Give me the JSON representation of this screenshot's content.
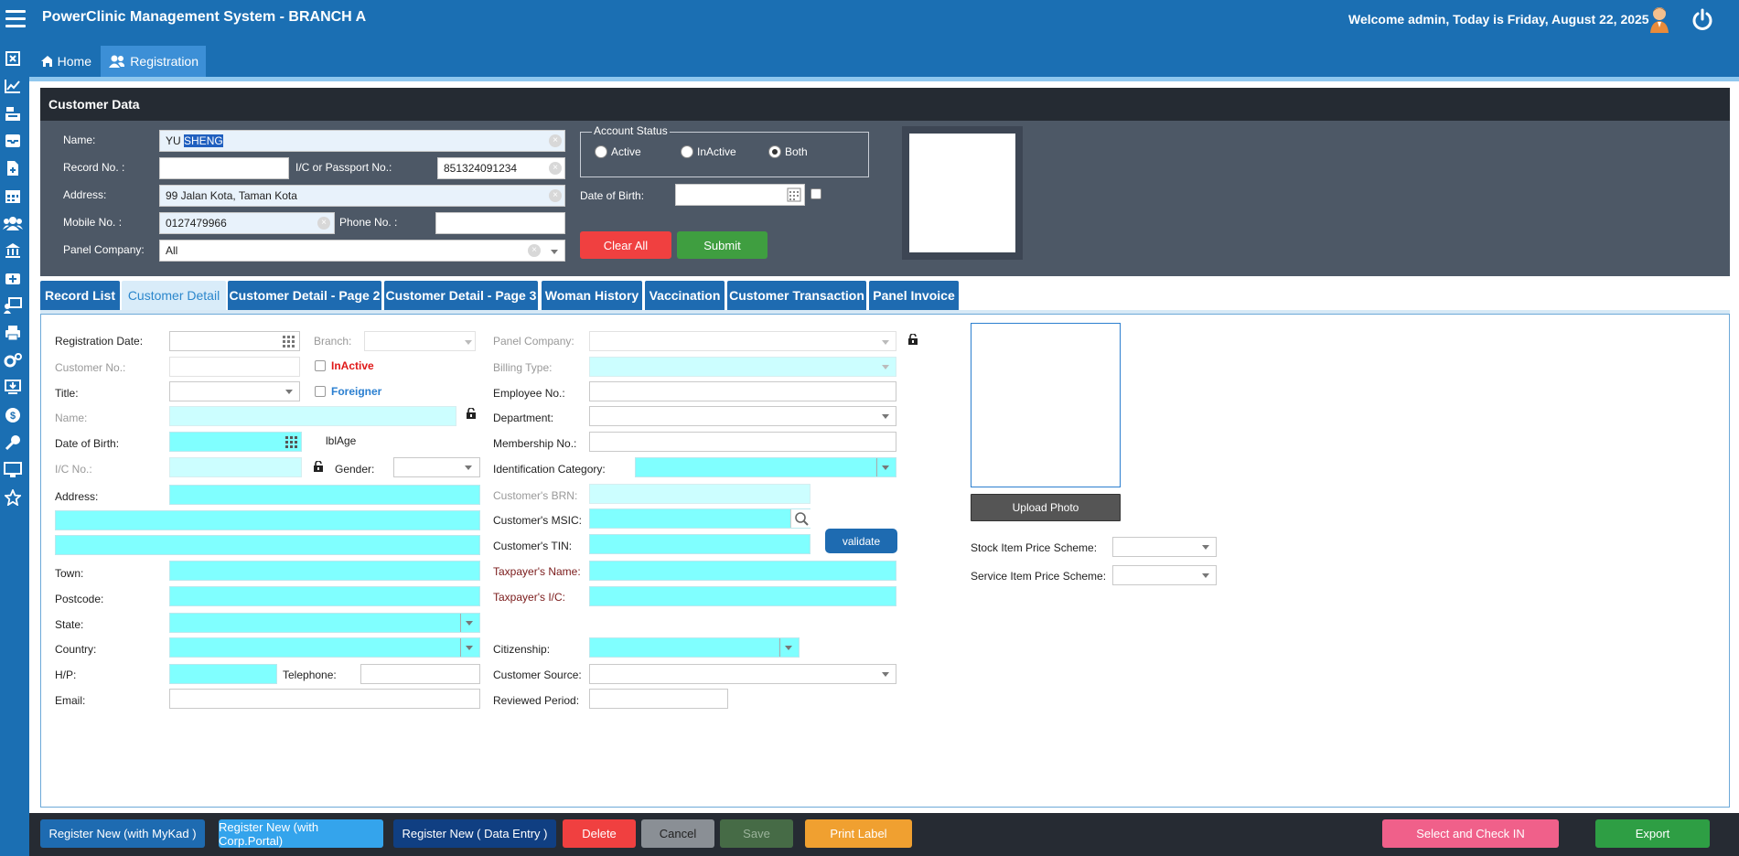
{
  "app": {
    "title": "PowerClinic Management System - BRANCH A",
    "welcome": "Welcome admin, Today is Friday, August 22, 2025"
  },
  "sidebar": {
    "icons": [
      "close-box-icon",
      "chart-line-icon",
      "cash-register-icon",
      "inbox-icon",
      "file-medical-icon",
      "calendar-icon",
      "users-icon",
      "bank-icon",
      "medical-kit-icon",
      "monitor-user-icon",
      "printer-icon",
      "cogs-icon",
      "screen-download-icon",
      "money-bag-icon",
      "key-icon",
      "desktop-icon",
      "star-icon"
    ]
  },
  "nav": {
    "home": "Home",
    "registration": "Registration"
  },
  "customer_data": {
    "header": "Customer Data",
    "name_label": "Name:",
    "name_value_plain": "YU ",
    "name_value_selected": "SHENG",
    "record_label": "Record No. :",
    "record_value": "",
    "ic_label": "I/C or Passport No.:",
    "ic_value": "851324091234",
    "address_label": "Address:",
    "address_value": "99 Jalan Kota, Taman Kota",
    "mobile_label": "Mobile No. :",
    "mobile_value": "0127479966",
    "phone_label": "Phone No. :",
    "phone_value": "",
    "panel_label": "Panel Company:",
    "panel_value": "All",
    "account_status_legend": "Account Status",
    "status_options": [
      "Active",
      "InActive",
      "Both"
    ],
    "status_selected": "Both",
    "dob_label": "Date of Birth:",
    "dob_value": "",
    "clear_all": "Clear All",
    "submit": "Submit"
  },
  "tabs": [
    "Record List",
    "Customer Detail",
    "Customer Detail - Page 2",
    "Customer Detail - Page 3",
    "Woman History",
    "Vaccination",
    "Customer Transaction",
    "Panel Invoice"
  ],
  "active_tab": "Customer Detail",
  "detail": {
    "registration_date": "Registration Date:",
    "branch": "Branch:",
    "panel_company": "Panel Company:",
    "customer_no": "Customer No.:",
    "inactive": "InActive",
    "billing_type": "Billing Type:",
    "title": "Title:",
    "foreigner": "Foreigner",
    "employee_no": "Employee No.:",
    "name": "Name:",
    "department": "Department:",
    "dob": "Date of Birth:",
    "lbl_age": "lblAge",
    "membership_no": "Membership No.:",
    "ic_no": "I/C No.:",
    "gender": "Gender:",
    "identification_category": "Identification Category:",
    "address": "Address:",
    "customers_brn": "Customer's BRN:",
    "customers_msic": "Customer's MSIC:",
    "customers_tin": "Customer's TIN:",
    "validate": "validate",
    "town": "Town:",
    "taxpayers_name": "Taxpayer's Name:",
    "postcode": "Postcode:",
    "taxpayers_ic": "Taxpayer's I/C:",
    "state": "State:",
    "country": "Country:",
    "citizenship": "Citizenship:",
    "hp": "H/P:",
    "telephone": "Telephone:",
    "customer_source": "Customer Source:",
    "email": "Email:",
    "reviewed_period": "Reviewed Period:",
    "upload_photo": "Upload Photo",
    "stock_scheme": "Stock Item Price Scheme:",
    "service_scheme": "Service Item Price Scheme:"
  },
  "footer": {
    "register_mykad": "Register New (with MyKad )",
    "register_corp": "Register New (with Corp.Portal)",
    "register_data": "Register New ( Data Entry )",
    "delete": "Delete",
    "cancel": "Cancel",
    "save": "Save",
    "print_label": "Print Label",
    "select_checkin": "Select and Check IN",
    "export": "Export"
  },
  "colors": {
    "primary": "#1b6fb3",
    "header_dark": "#252b33",
    "panel_grey": "#4d5866",
    "cyan_field": "#80ffff",
    "danger": "#f04040",
    "success": "#3f9e40",
    "warning": "#f0a030",
    "pink": "#f0608a"
  }
}
